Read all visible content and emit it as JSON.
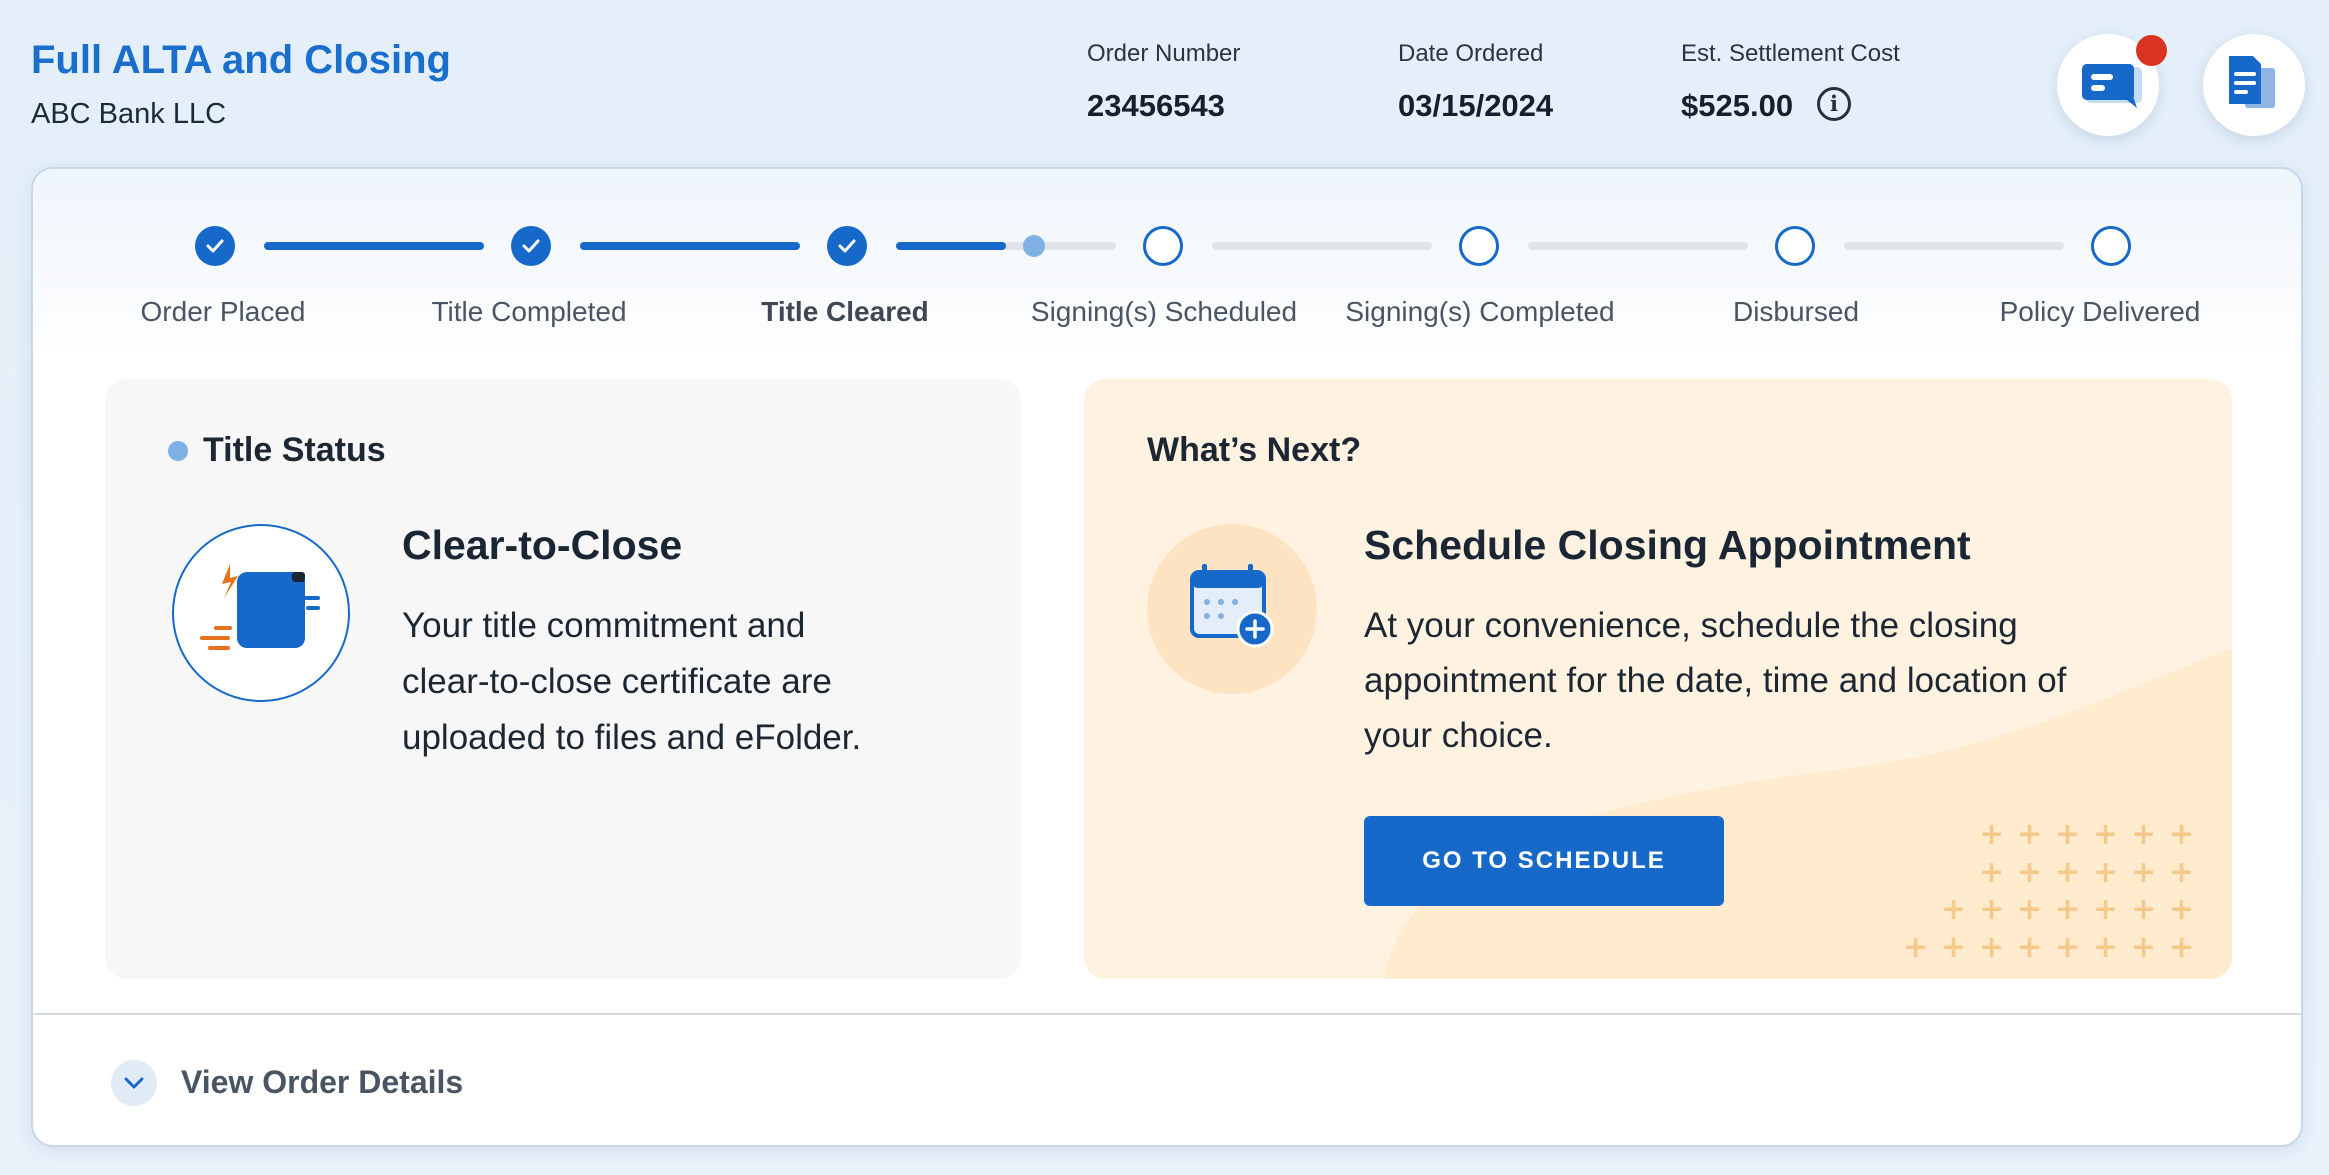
{
  "header": {
    "title": "Full ALTA and Closing",
    "subtitle": "ABC Bank LLC",
    "order_number_label": "Order Number",
    "order_number": "23456543",
    "date_ordered_label": "Date Ordered",
    "date_ordered": "03/15/2024",
    "settlement_label": "Est. Settlement Cost",
    "settlement_value": "$525.00",
    "info_glyph": "i"
  },
  "progress": {
    "steps": [
      {
        "label": "Order Placed",
        "status": "complete"
      },
      {
        "label": "Title Completed",
        "status": "complete"
      },
      {
        "label": "Title Cleared",
        "status": "current"
      },
      {
        "label": "Signing(s) Scheduled",
        "status": "pending"
      },
      {
        "label": "Signing(s) Completed",
        "status": "pending"
      },
      {
        "label": "Disbursed",
        "status": "pending"
      },
      {
        "label": "Policy Delivered",
        "status": "pending"
      }
    ],
    "current_segment_fraction": 0.5
  },
  "title_status": {
    "heading": "Title Status",
    "title": "Clear-to-Close",
    "body_lines": [
      "Your title commitment and",
      "clear-to-close certificate are",
      "uploaded to files and eFolder."
    ]
  },
  "whats_next": {
    "heading": "What’s Next?",
    "title": "Schedule Closing Appointment",
    "body_lines": [
      "At your convenience, schedule the closing",
      "appointment for the date, time and location of",
      "your choice."
    ],
    "button_label": "GO TO SCHEDULE"
  },
  "footer": {
    "details_label": "View Order Details"
  },
  "icons": {
    "chat": "chat-icon",
    "documents": "documents-icon",
    "info": "info-icon",
    "check": "check-icon",
    "title_doc": "document-fast-icon",
    "calendar": "calendar-add-icon",
    "chevron": "chevron-down-icon"
  },
  "colors": {
    "accent": "#1669c9",
    "title": "#1a6fcd",
    "notification": "#d93321",
    "whats_next_bg": "#fff2e0",
    "status_bg": "#f7f7f8"
  }
}
